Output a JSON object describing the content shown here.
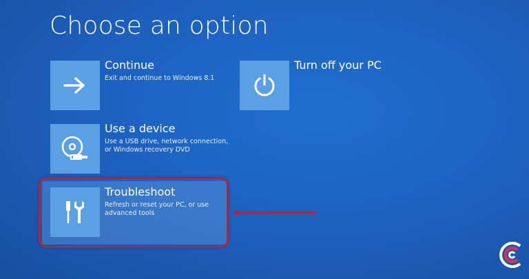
{
  "page": {
    "title": "Choose an option"
  },
  "options": [
    {
      "title": "Continue",
      "description": "Exit and continue to Windows 8.1",
      "icon": "arrow-right-icon"
    },
    {
      "title": "Use a device",
      "description": "Use a USB drive, network connection,\nor Windows recovery DVD",
      "icon": "disc-drive-icon"
    },
    {
      "title": "Troubleshoot",
      "description": "Refresh or reset your PC, or use\nadvanced tools",
      "icon": "tools-icon"
    },
    {
      "title": "Turn off your PC",
      "description": "",
      "icon": "power-icon"
    }
  ],
  "colors": {
    "background": "#1d5fbc",
    "tile": "#5aa0e2",
    "annotation": "#b0243c"
  }
}
